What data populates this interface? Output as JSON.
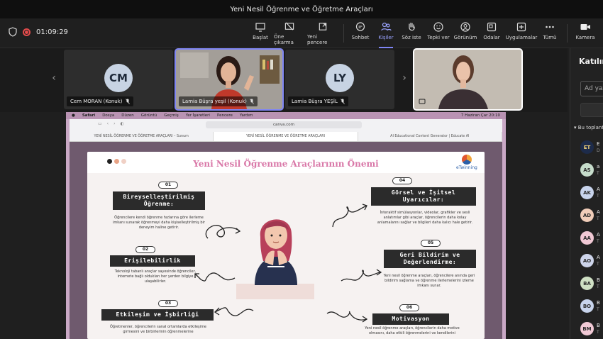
{
  "window": {
    "title": "Yeni Nesil Öğrenme ve Öğretme Araçları"
  },
  "toolbar": {
    "timer": "01:09:29",
    "buttons": [
      {
        "id": "start",
        "label": "Başlat"
      },
      {
        "id": "stop-share",
        "label": "Öne çıkarma"
      },
      {
        "id": "new-window",
        "label": "Yeni pencere"
      },
      {
        "id": "chat",
        "label": "Sohbet"
      },
      {
        "id": "people",
        "label": "Kişiler"
      },
      {
        "id": "raise",
        "label": "Söz iste"
      },
      {
        "id": "react",
        "label": "Tepki ver"
      },
      {
        "id": "view",
        "label": "Görünüm"
      },
      {
        "id": "rooms",
        "label": "Odalar"
      },
      {
        "id": "apps",
        "label": "Uygulamalar"
      },
      {
        "id": "more",
        "label": "Tümü"
      },
      {
        "id": "camera",
        "label": "Kamera"
      }
    ]
  },
  "participants": [
    {
      "initials": "CM",
      "name": "Cem MORAN (Konuk)"
    },
    {
      "initials": "",
      "name": "Lamia Büşra yeşil (Konuk)"
    },
    {
      "initials": "LY",
      "name": "Lamia Büşra YEŞİL"
    }
  ],
  "panel": {
    "title": "Katılımcılar",
    "search_placeholder": "Ad yaz",
    "section": "Bu toplantıda",
    "people": [
      {
        "initials": "ET",
        "name": "E",
        "sub": "D",
        "color": "#1d2b4a"
      },
      {
        "initials": "AS",
        "name": "a",
        "sub": "T",
        "color": "#c6dccb"
      },
      {
        "initials": "AK",
        "name": "A",
        "sub": "T",
        "color": "#c8d4ec"
      },
      {
        "initials": "AD",
        "name": "A",
        "sub": "T",
        "color": "#f1cdb9"
      },
      {
        "initials": "AA",
        "name": "A",
        "sub": "T",
        "color": "#f1c9d5"
      },
      {
        "initials": "AO",
        "name": "A",
        "sub": "T",
        "color": "#cdd4ea"
      },
      {
        "initials": "BA",
        "name": "B",
        "sub": "T",
        "color": "#cfe0c4"
      },
      {
        "initials": "BO",
        "name": "B",
        "sub": "T",
        "color": "#c8d4ec"
      },
      {
        "initials": "BM",
        "name": "B",
        "sub": "T",
        "color": "#f1c9d5"
      }
    ]
  },
  "share": {
    "mac_menu": [
      "Safari",
      "Dosya",
      "Düzen",
      "Görüntü",
      "Geçmiş",
      "Yer İşaretleri",
      "Pencere",
      "Yardım"
    ],
    "mac_clock": "7 Haziran Çar  20:10",
    "url": "canva.com",
    "tabs": [
      "YENİ NESİL ÖĞRENME VE ÖĞRETME ARAÇLARI – Sunum",
      "YENİ NESİL ÖĞRENME VE ÖĞRETME ARAÇLARI",
      "AI Educational Content Generator | Educate AI"
    ]
  },
  "slide": {
    "title": "Yeni Nesil Öğrenme Araçlarının Önemi",
    "logo": "eTwinning",
    "items": [
      {
        "num": "01",
        "label": "Bireyselleştirilmiş Öğrenme:",
        "body": "Öğrencilere kendi öğrenme hızlarına göre ilerleme imkanı sunarak öğrenmeyi daha kişiselleştirilmiş bir deneyim haline getirir."
      },
      {
        "num": "02",
        "label": "Erişilebilirlik",
        "body": "Teknoloji tabanlı araçlar sayesinde öğrenciler, internete bağlı oldukları her yerden bilgiye ulaşabilirler."
      },
      {
        "num": "03",
        "label": "Etkileşim ve İşbirliği",
        "body": "Öğretmenler, öğrencilerin sanal ortamlarda etkileşime girmesini ve birbirlerinin öğrenmelerine"
      },
      {
        "num": "04",
        "label": "Görsel ve İşitsel Uyarıcılar:",
        "body": "İnteraktif simülasyonlar, videolar, grafikler ve sesli anlatımlar gibi araçlar, öğrencilerin daha kolay anlamalarını sağlar ve bilgileri daha kalıcı hale getirir."
      },
      {
        "num": "05",
        "label": "Geri Bildirim ve Değerlendirme:",
        "body": "Yeni nesil öğrenme araçları, öğrencilere anında geri bildirim sağlama ve öğrenme ilerlemelerini izleme imkanı sunar."
      },
      {
        "num": "06",
        "label": "Motivasyon",
        "body": "Yeni nesil öğrenme araçları, öğrencilerin daha motive olmasını, daha etkili öğrenmelerini ve kendilerini"
      }
    ]
  }
}
